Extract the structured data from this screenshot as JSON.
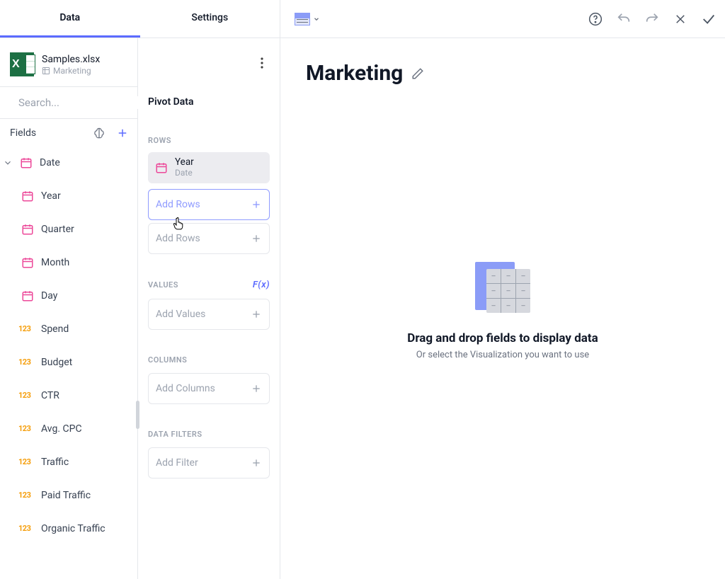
{
  "tabs": {
    "data": "Data",
    "settings": "Settings"
  },
  "datasource": {
    "filename": "Samples.xlsx",
    "sheet": "Marketing"
  },
  "search": {
    "placeholder": "Search..."
  },
  "fields_header": {
    "label": "Fields"
  },
  "fields": {
    "date_group": "Date",
    "year": "Year",
    "quarter": "Quarter",
    "month": "Month",
    "day": "Day",
    "spend": "Spend",
    "budget": "Budget",
    "ctr": "CTR",
    "avg_cpc": "Avg. CPC",
    "traffic": "Traffic",
    "paid_traffic": "Paid Traffic",
    "organic_traffic": "Organic Traffic"
  },
  "num_badge": "123",
  "pivot": {
    "title": "Pivot Data",
    "rows_label": "ROWS",
    "values_label": "VALUES",
    "columns_label": "COLUMNS",
    "filters_label": "DATA FILTERS",
    "fx": "F(x)",
    "row_item": {
      "name": "Year",
      "type": "Date"
    },
    "add_rows": "Add Rows",
    "add_values": "Add Values",
    "add_columns": "Add Columns",
    "add_filter": "Add Filter"
  },
  "canvas": {
    "title": "Marketing",
    "empty_title": "Drag and drop fields to display data",
    "empty_sub": "Or select the Visualization you want to use"
  }
}
